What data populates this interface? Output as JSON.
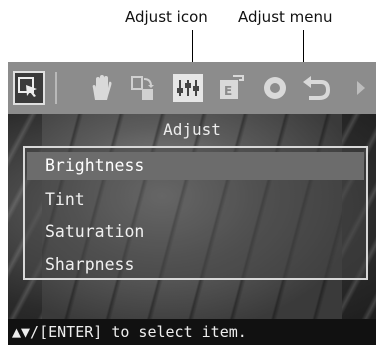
{
  "callouts": {
    "adjust_icon": "Adjust icon",
    "adjust_menu": "Adjust menu"
  },
  "toolbar": {
    "icons": [
      "pointer-icon",
      "hand-icon",
      "rotate-crop-icon",
      "adjust-icon",
      "edit-frame-icon",
      "red-eye-icon",
      "undo-icon",
      "next-arrow-icon"
    ],
    "selected": "adjust-icon"
  },
  "menu": {
    "title": "Adjust",
    "items": [
      "Brightness",
      "Tint",
      "Saturation",
      "Sharpness"
    ],
    "selected_index": 0
  },
  "status": {
    "text": "▲▼/[ENTER] to select item."
  },
  "colors": {
    "toolbar_bg": "#8c8c8c",
    "screen_bg": "#1b1b1b",
    "selected_item_bg": "#6c6c6c"
  }
}
